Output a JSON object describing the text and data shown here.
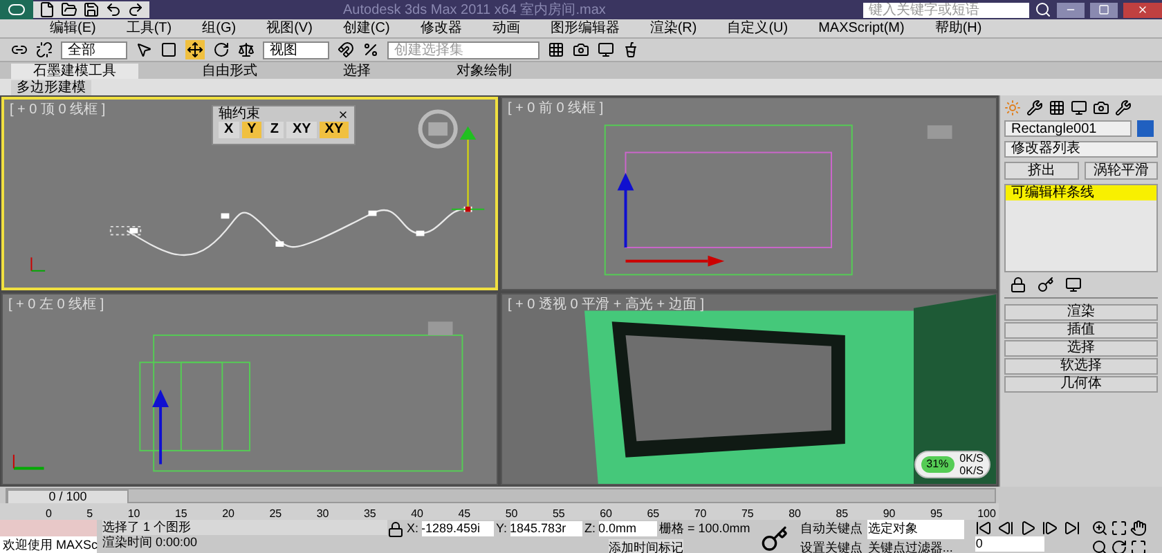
{
  "title_bar": {
    "title": "Autodesk 3ds Max 2011 x64    室内房间.max",
    "search": {
      "placeholder": "键入关键字或短语"
    }
  },
  "menu": [
    "编辑(E)",
    "工具(T)",
    "组(G)",
    "视图(V)",
    "创建(C)",
    "修改器",
    "动画",
    "图形编辑器",
    "渲染(R)",
    "自定义(U)",
    "MAXScript(M)",
    "帮助(H)"
  ],
  "toolbar": {
    "selection_filter": "全部",
    "reference_coord": "视图",
    "named_selection": {
      "placeholder": "创建选择集"
    }
  },
  "ribbon": {
    "tabs": [
      {
        "label": "石墨建模工具",
        "selected": true
      },
      {
        "label": "自由形式",
        "selected": false
      },
      {
        "label": "选择",
        "selected": false
      },
      {
        "label": "对象绘制",
        "selected": false
      }
    ],
    "panel": "多边形建模"
  },
  "viewports": [
    {
      "label": "[ + 0 顶 0 线框 ]",
      "kind": "top",
      "active": true
    },
    {
      "label": "[ + 0 前 0 线框 ]",
      "kind": "front",
      "active": false
    },
    {
      "label": "[ + 0 左 0 线框 ]",
      "kind": "left",
      "active": false
    },
    {
      "label": "[ + 0 透视 0 平滑 + 高光 + 边面 ]",
      "kind": "perspective",
      "active": false
    }
  ],
  "axis_constraints": {
    "title": "轴约束",
    "buttons": [
      {
        "label": "X",
        "selected": false
      },
      {
        "label": "Y",
        "selected": true
      },
      {
        "label": "Z",
        "selected": false
      },
      {
        "label": "XY",
        "selected": false
      },
      {
        "label": "XY",
        "selected": true
      }
    ]
  },
  "command_panel": {
    "object_name": "Rectangle001",
    "modifier_list": "修改器列表",
    "buttons": [
      "挤出",
      "涡轮平滑"
    ],
    "stack": [
      {
        "label": "可编辑样条线",
        "selected": true
      }
    ],
    "rollouts": [
      "渲染",
      "插值",
      "选择",
      "软选择",
      "几何体"
    ]
  },
  "performance": {
    "percent": "31%",
    "rates": [
      "0K/S",
      "0K/S"
    ]
  },
  "timeline": {
    "frame": "0 / 100",
    "level": 0,
    "ticks": [
      "0",
      "5",
      "10",
      "15",
      "20",
      "25",
      "30",
      "35",
      "40",
      "45",
      "50",
      "55",
      "60",
      "65",
      "70",
      "75",
      "80",
      "85",
      "90",
      "95",
      "100"
    ]
  },
  "status": {
    "maxscript": "欢迎使用 MAXSc",
    "message": "选择了 1 个图形",
    "prompt": "渲染时间  0:00:00",
    "x_label": "X:",
    "x": "-1289.459i",
    "y_label": "Y:",
    "y": "1845.783r",
    "z_label": "Z:",
    "z": "0.0mm",
    "grid": "栅格 = 100.0mm",
    "time_tag": "添加时间标记",
    "auto_key": "自动关键点",
    "set_key": "设置关键点",
    "key_mode": "选定对象",
    "key_filters": "关键点过滤器...",
    "current_frame": "0"
  }
}
